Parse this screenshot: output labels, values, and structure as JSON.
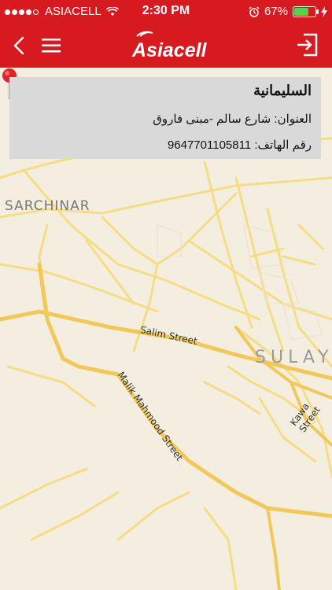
{
  "status_bar": {
    "carrier": "ASIACELL",
    "time": "2:30 PM",
    "battery": "67%",
    "battery_level": 0.67
  },
  "header": {
    "brand": "Asiacell",
    "icons": [
      "back-icon",
      "hamburger-menu-icon",
      "logout-icon"
    ]
  },
  "location": {
    "city": "السليمانية",
    "address": "العنوان: شارع سالم -مبنى فاروق",
    "phone": "رقم الهاتف: 9647701105811"
  },
  "map": {
    "labels": {
      "sarchinar": "SARCHINAR",
      "sulay": "SULAY",
      "salim": "Salim Street",
      "malik": "Malik Mahmood Street",
      "kawa": "Kawa Street"
    },
    "colors": {
      "background": "#f3eee0",
      "road": "#f7dc86",
      "major_road": "#f2c85a",
      "pin": "#e3232b"
    }
  },
  "theme": {
    "brand_red": "#d71920",
    "card_bg": "#d9d9d9"
  }
}
